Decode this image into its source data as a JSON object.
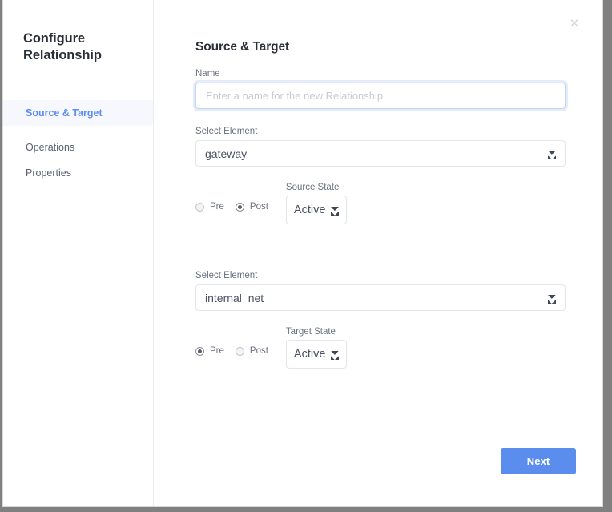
{
  "sidebar": {
    "title": "Configure Relationship",
    "items": [
      {
        "label": "Source & Target",
        "active": true
      },
      {
        "label": "Operations",
        "active": false
      },
      {
        "label": "Properties",
        "active": false
      }
    ]
  },
  "main": {
    "close_icon": "close-icon",
    "close_glyph": "✕",
    "page_title": "Source & Target",
    "name_field": {
      "label": "Name",
      "value": "",
      "placeholder": "Enter a name for the new Relationship"
    },
    "source": {
      "element_label": "Select Element",
      "element_value": "gateway",
      "radio_pre_label": "Pre",
      "radio_post_label": "Post",
      "radio_selected": "Post",
      "state_label": "Source State",
      "state_value": "Active"
    },
    "target": {
      "element_label": "Select Element",
      "element_value": "internal_net",
      "radio_pre_label": "Pre",
      "radio_post_label": "Post",
      "radio_selected": "Pre",
      "state_label": "Target State",
      "state_value": "Active"
    },
    "next_button_label": "Next"
  },
  "colors": {
    "accent": "#5b8def",
    "active_nav_bg": "#f6f8fd",
    "text_primary": "#2b2f38",
    "text_secondary": "#6b7080",
    "border": "#e3e6ec",
    "focus_ring": "#c6d4f2"
  }
}
